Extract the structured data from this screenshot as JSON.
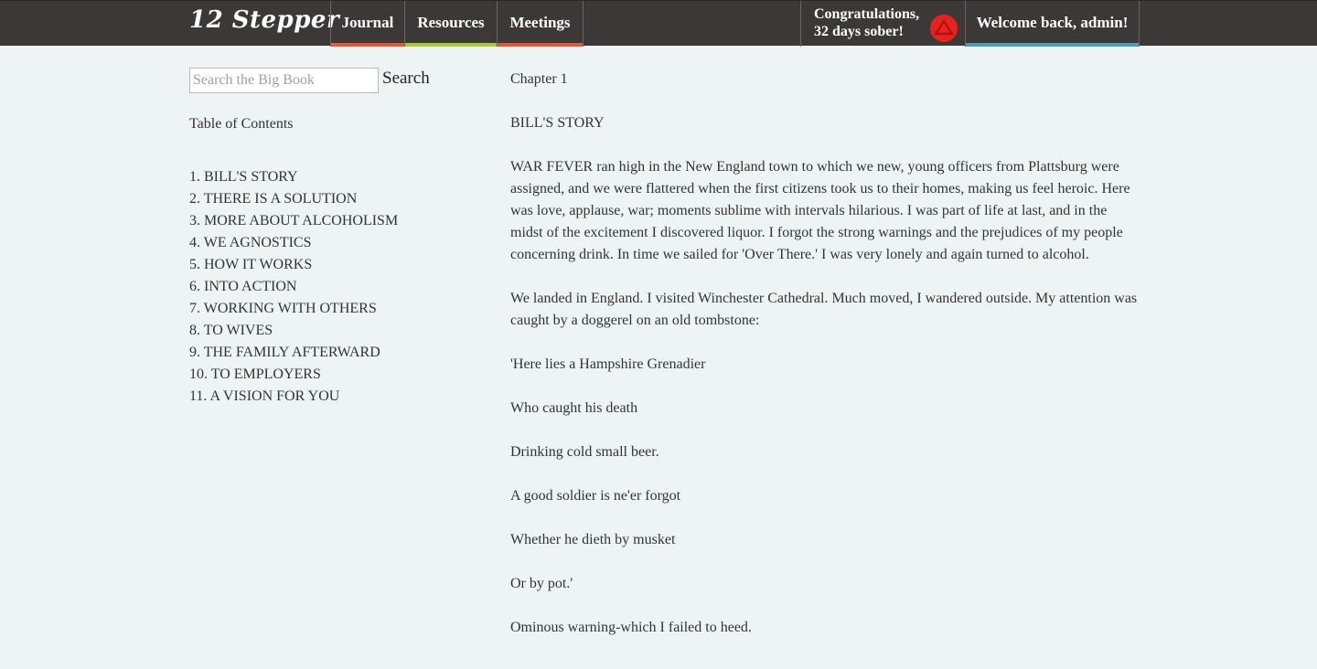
{
  "header": {
    "brand": "12 Stepper",
    "nav": [
      {
        "label": "Journal",
        "accent": "#e05a3b"
      },
      {
        "label": "Resources",
        "accent": "#a7c936"
      },
      {
        "label": "Meetings",
        "accent": "#e05a3b"
      }
    ],
    "congrats_line1": "Congratulations,",
    "congrats_line2": "32 days sober!",
    "badge_icon": "aa-triangle-icon",
    "welcome": "Welcome back, admin!",
    "welcome_accent": "#4a9fb8"
  },
  "sidebar": {
    "search_placeholder": "Search the Big Book",
    "search_value": "",
    "search_button": "Search",
    "toc_title": "Table of Contents",
    "toc": [
      "1. BILL'S STORY",
      "2. THERE IS A SOLUTION",
      "3. MORE ABOUT ALCOHOLISM",
      "4. WE AGNOSTICS",
      "5. HOW IT WORKS",
      "6. INTO ACTION",
      "7. WORKING WITH OTHERS",
      "8. TO WIVES",
      "9. THE FAMILY AFTERWARD",
      "10. TO EMPLOYERS",
      "11. A VISION FOR YOU"
    ]
  },
  "main": {
    "chapter": "Chapter 1",
    "title": "BILL'S STORY",
    "paragraphs": [
      "WAR FEVER ran high in the New England town to which we new, young officers from Plattsburg were assigned, and we were flattered when the first citizens took us to their homes, making us feel heroic. Here was love, applause, war; moments sublime with intervals hilarious. I was part of life at last, and in the midst of the excitement I discovered liquor. I forgot the strong warnings and the prejudices of my people concerning drink. In time we sailed for 'Over There.' I was very lonely and again turned to alcohol.",
      "We landed in England. I visited Winchester Cathedral. Much moved, I wandered outside. My attention was caught by a doggerel on an old tombstone:",
      "'Here lies a Hampshire Grenadier",
      "Who caught his death",
      "Drinking cold small beer.",
      "A good soldier is ne'er forgot",
      "Whether he dieth by musket",
      "Or by pot.'",
      "Ominous warning-which I failed to heed."
    ]
  }
}
